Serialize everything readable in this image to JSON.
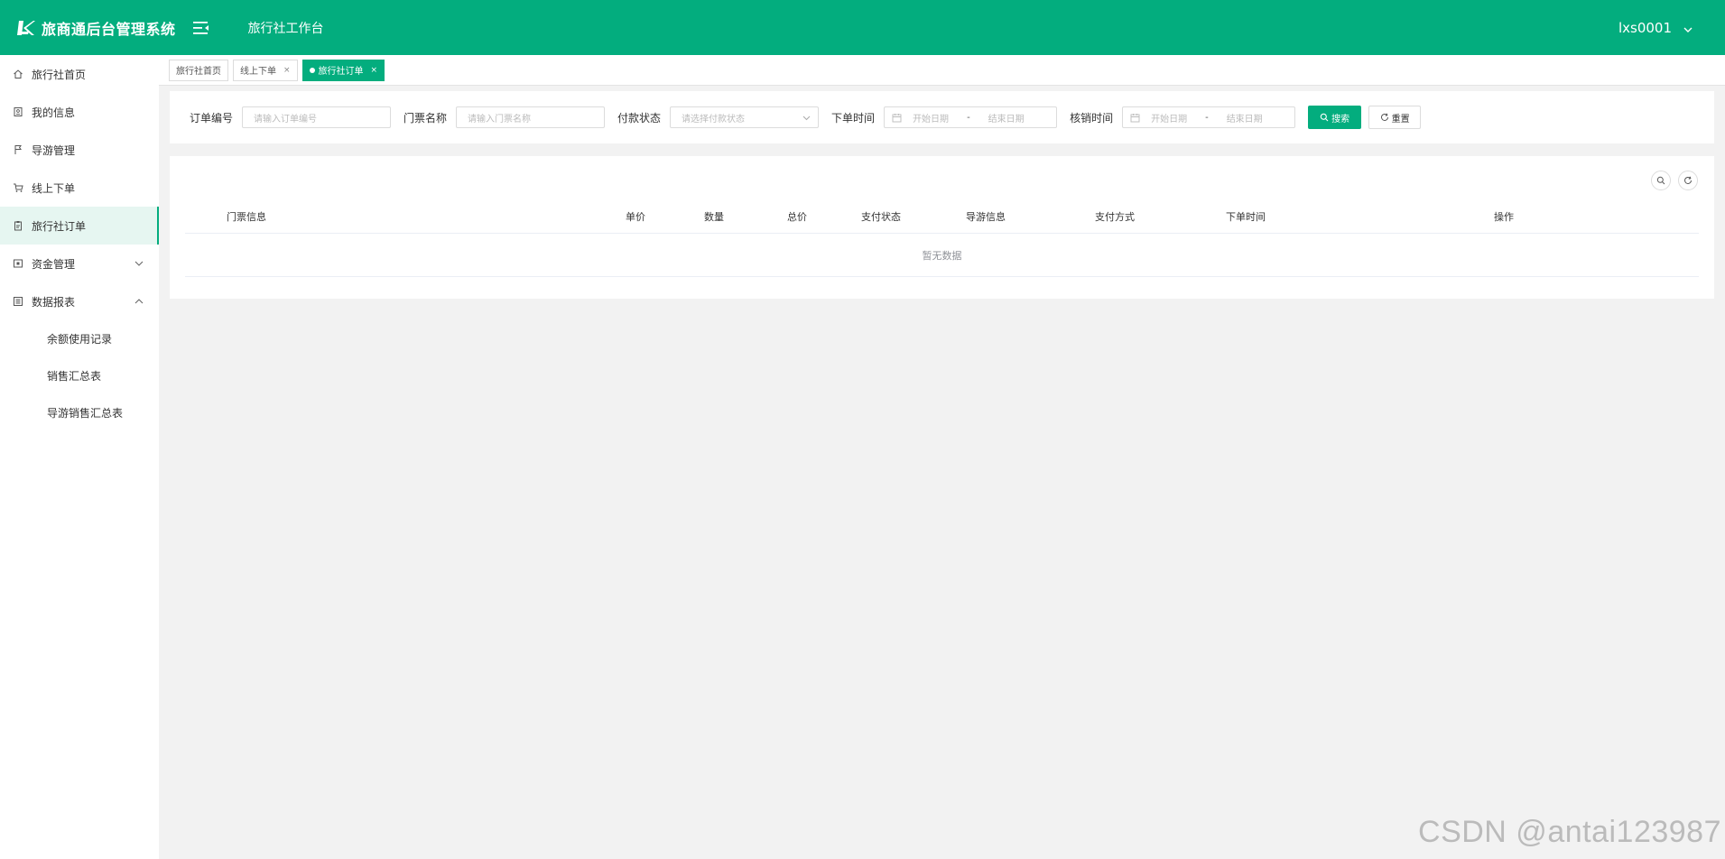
{
  "header": {
    "app_title": "旅商通后台管理系统",
    "workspace_title": "旅行社工作台",
    "username": "lxs0001",
    "brand_color": "#03ad7e"
  },
  "sidebar": {
    "items": [
      {
        "label": "旅行社首页",
        "icon": "home-icon"
      },
      {
        "label": "我的信息",
        "icon": "profile-icon"
      },
      {
        "label": "导游管理",
        "icon": "flag-icon"
      },
      {
        "label": "线上下单",
        "icon": "cart-icon"
      },
      {
        "label": "旅行社订单",
        "icon": "clipboard-icon",
        "active": true
      },
      {
        "label": "资金管理",
        "icon": "wallet-icon",
        "expanded": false
      },
      {
        "label": "数据报表",
        "icon": "report-icon",
        "expanded": true
      }
    ],
    "report_subitems": [
      "余额使用记录",
      "销售汇总表",
      "导游销售汇总表"
    ]
  },
  "tabs": [
    {
      "label": "旅行社首页",
      "closable": false
    },
    {
      "label": "线上下单",
      "closable": true
    },
    {
      "label": "旅行社订单",
      "closable": true,
      "active": true
    }
  ],
  "tab_close_glyph": "×",
  "search": {
    "order_no_label": "订单编号",
    "order_no_placeholder": "请输入订单编号",
    "ticket_name_label": "门票名称",
    "ticket_name_placeholder": "请输入门票名称",
    "pay_status_label": "付款状态",
    "pay_status_placeholder": "请选择付款状态",
    "order_time_label": "下单时间",
    "verify_time_label": "核销时间",
    "start_date_placeholder": "开始日期",
    "end_date_placeholder": "结束日期",
    "range_separator": "-",
    "search_button": "搜索",
    "reset_button": "重置"
  },
  "table": {
    "columns": [
      "门票信息",
      "单价",
      "数量",
      "总价",
      "支付状态",
      "导游信息",
      "支付方式",
      "下单时间",
      "操作"
    ],
    "empty_text": "暂无数据"
  },
  "watermark": "CSDN @antai123987"
}
